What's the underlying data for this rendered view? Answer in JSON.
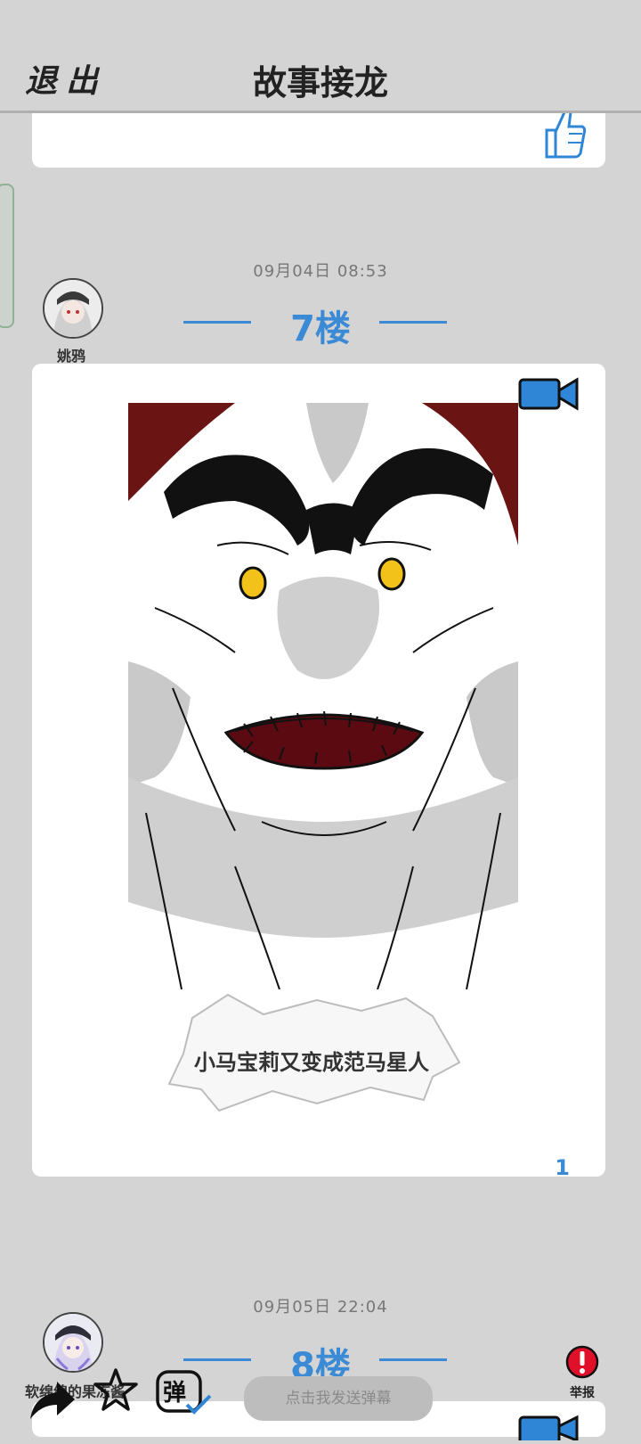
{
  "header": {
    "exit_label": "退出",
    "title": "故事接龙"
  },
  "posts": [
    {
      "date": "09月04日  08:53",
      "floor": "7楼",
      "username": "姚鸦",
      "caption": "小马宝莉又变成范马星人",
      "like_count": "1"
    },
    {
      "date": "09月05日  22:04",
      "floor": "8楼",
      "username": "软绵绵的果冻酱"
    }
  ],
  "bottom_bar": {
    "danmu_placeholder": "点击我发送弹幕",
    "danmu_toggle_label": "弹",
    "report_label": "举报"
  },
  "colors": {
    "accent": "#3a8ad6",
    "background": "#d4d4d4",
    "report": "#e0102a"
  },
  "icons": [
    "thumbs-up-icon",
    "video-camera-icon",
    "share-arrow-icon",
    "star-icon",
    "danmu-toggle-icon",
    "report-alert-icon"
  ]
}
